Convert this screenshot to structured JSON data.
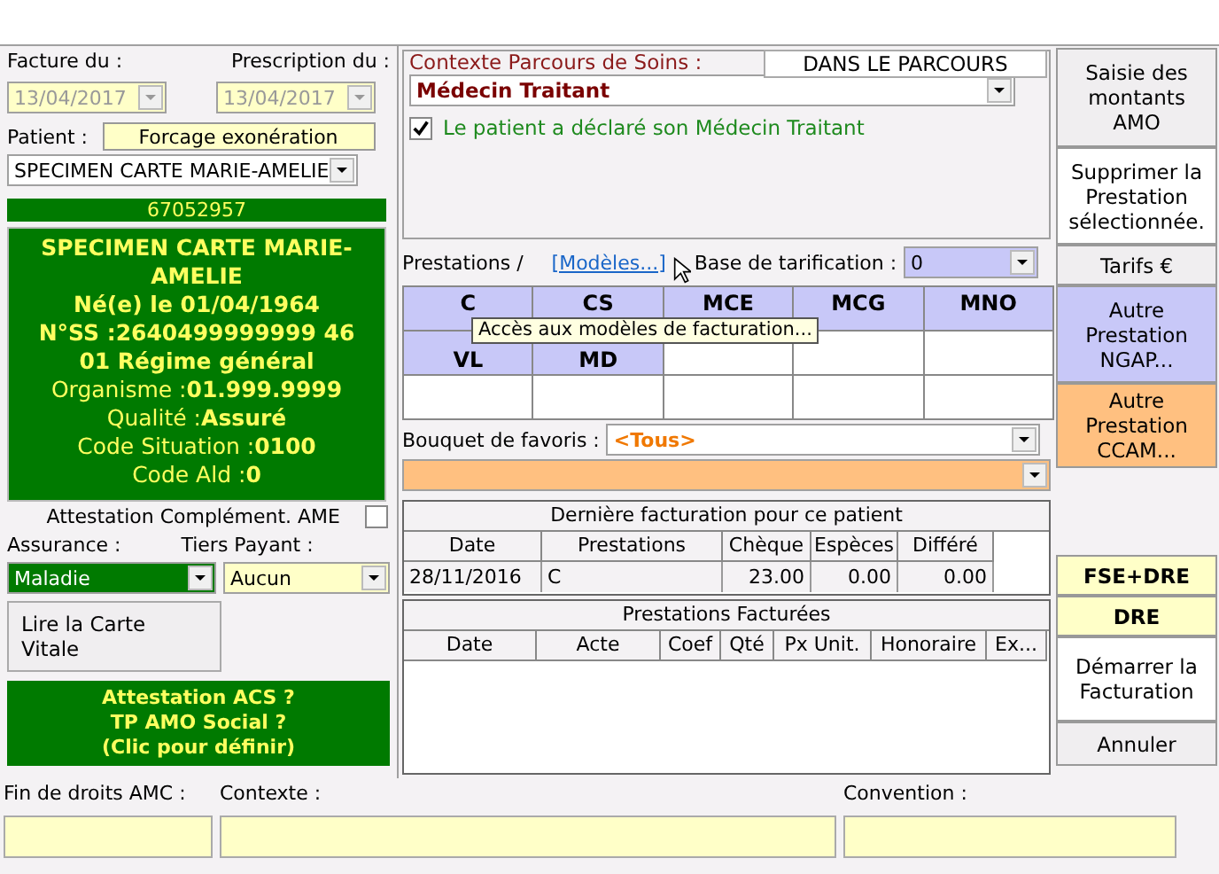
{
  "billing": {
    "invoice_label": "Facture du :",
    "invoice_date": {
      "value": "13/04/2017",
      "disabled": true
    },
    "prescription_label": "Prescription du :",
    "prescription_date": {
      "value": "13/04/2017",
      "disabled": true
    }
  },
  "patient": {
    "label": "Patient :",
    "exemption_button": "Forcage exonération",
    "selector": "SPECIMEN CARTE MARIE-AMELIE",
    "card_number": "67052957",
    "info_lines": [
      "**SPECIMEN CARTE MARIE-AMELIE**",
      "**Né(e) le 01/04/1964**",
      "**N°SS :2640499999999 46**",
      "**01 Régime général**",
      "Organisme :**01.999.9999**",
      "Qualité :**Assuré**",
      "Code Situation :**0100**",
      "Code Ald :**0**"
    ],
    "ame": {
      "label": "Attestation Complément. AME",
      "checked": false
    },
    "insurance_label": "Assurance :",
    "insurance": "Maladie",
    "third_party_label": "Tiers Payant :",
    "third_party": "Aucun",
    "read_card_button": "Lire la Carte Vitale",
    "acs_lines": [
      "Attestation ACS ?",
      "TP AMO Social ?",
      "(Clic pour définir)"
    ]
  },
  "care_pathway": {
    "legend": "Contexte Parcours de Soins :",
    "status": "DANS LE PARCOURS",
    "doctor": "Médecin Traitant",
    "declared": {
      "label": "Le patient a déclaré son Médecin Traitant",
      "checked": true
    }
  },
  "services": {
    "label": "Prestations /",
    "models_link": "[Modèles...]",
    "pricing_label": "Base de tarification :",
    "pricing_value": "0",
    "acts": [
      [
        {
          "label": "C",
          "kind": "act"
        },
        {
          "label": "CS",
          "kind": "act"
        },
        {
          "label": "MCE",
          "kind": "act"
        },
        {
          "label": "MCG",
          "kind": "act"
        },
        {
          "label": "MNO",
          "kind": "act"
        }
      ],
      [
        {
          "label": "VL",
          "kind": "act"
        },
        {
          "label": "MD",
          "kind": "act"
        },
        {
          "kind": "empty"
        },
        {
          "kind": "empty"
        },
        {
          "kind": "empty"
        }
      ],
      [
        {
          "kind": "empty"
        },
        {
          "kind": "empty"
        },
        {
          "kind": "empty"
        },
        {
          "kind": "empty"
        },
        {
          "kind": "empty"
        }
      ]
    ],
    "tooltip": "Accès aux modèles de facturation...",
    "favorites_label": "Bouquet de favoris :",
    "favorites_value": "<Tous>"
  },
  "last_billing": {
    "title": "Dernière facturation pour ce patient",
    "columns": [
      "Date",
      "Prestations",
      "Chèque",
      "Espèces",
      "Différé"
    ],
    "rows": [
      [
        "28/11/2016",
        "C",
        "23.00",
        "0.00",
        "0.00"
      ]
    ]
  },
  "billed_services": {
    "title": "Prestations Facturées",
    "columns": [
      "Date",
      "Acte",
      "Coef",
      "Qté",
      "Px Unit.",
      "Honoraire",
      "Ex..."
    ]
  },
  "actions": [
    {
      "label": "Saisie des montants AMO",
      "kind": "grey"
    },
    {
      "label": "Supprimer la Prestation sélectionnée.",
      "kind": "white"
    },
    {
      "label": "Tarifs €",
      "kind": "grey"
    },
    {
      "label": "Autre Prestation NGAP...",
      "kind": "lavender"
    },
    {
      "label": "Autre Prestation CCAM...",
      "kind": "orange"
    },
    {
      "kind": "spacer"
    },
    {
      "label": "FSE+DRE",
      "kind": "yellow"
    },
    {
      "label": "DRE",
      "kind": "yellow"
    },
    {
      "label": "Démarrer la Facturation",
      "kind": "white"
    },
    {
      "label": "Annuler",
      "kind": "grey"
    }
  ],
  "footer": {
    "amc_label": "Fin de droits AMC :",
    "context_label": "Contexte :",
    "convention_label": "Convention :"
  }
}
